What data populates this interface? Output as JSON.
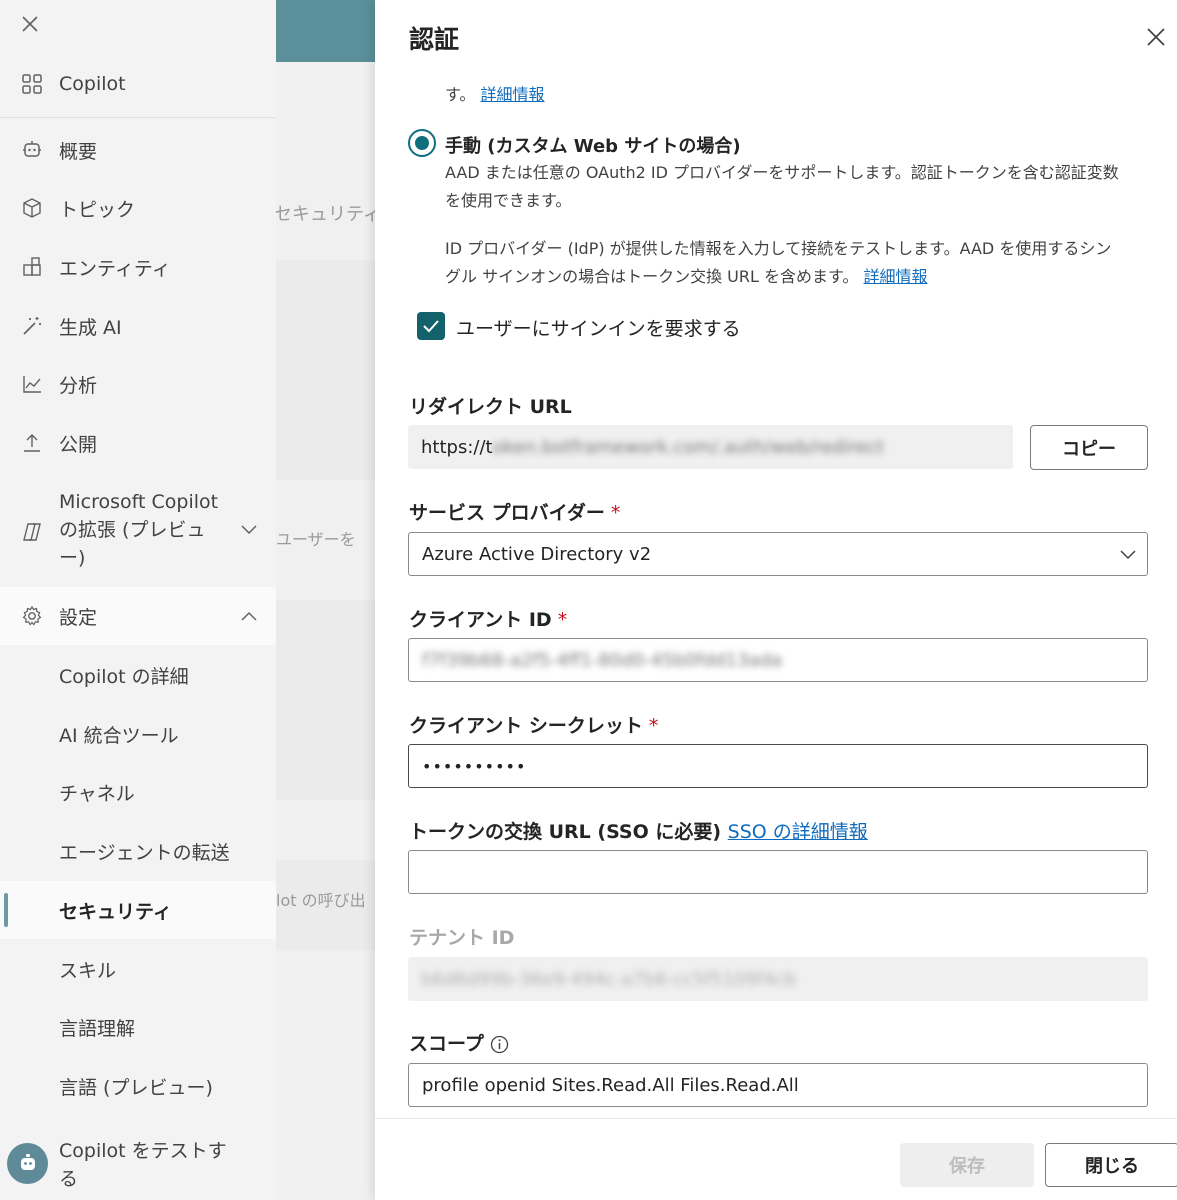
{
  "sidebar": {
    "copilot": "Copilot",
    "items": [
      {
        "label": "概要",
        "icon": "bot-icon"
      },
      {
        "label": "トピック",
        "icon": "cube-icon"
      },
      {
        "label": "エンティティ",
        "icon": "entity-icon"
      },
      {
        "label": "生成 AI",
        "icon": "wand-icon"
      },
      {
        "label": "分析",
        "icon": "chart-icon"
      },
      {
        "label": "公開",
        "icon": "upload-icon"
      }
    ],
    "extensions": "Microsoft Copilot の拡張 (プレビュー)",
    "extensions_lines": [
      "Microsoft Copilot",
      "の拡張 (プレビュ",
      "ー)"
    ],
    "settings": "設定",
    "sub_items": [
      "Copilot の詳細",
      "AI 統合ツール",
      "チャネル",
      "エージェントの転送",
      "セキュリティ",
      "スキル",
      "言語理解",
      "言語 (プレビュー)"
    ],
    "active_sub_item": "セキュリティ",
    "test": {
      "line1": "Copilot をテストす",
      "line2": "る"
    }
  },
  "background": {
    "fragment1": "セキュリティ",
    "fragment2": "ユーザーを",
    "fragment3": "lot の呼び出"
  },
  "panel": {
    "title": "認証",
    "cut_text": "す。",
    "learn_more": "詳細情報",
    "manual": {
      "label": "手動 (カスタム Web サイトの場合)",
      "desc_line1": "AAD または任意の OAuth2 ID プロバイダーをサポートします。認証トークンを含む認証変数",
      "desc_line2": "を使用できます。",
      "idp_line1": "ID プロバイダー (IdP) が提供した情報を入力して接続をテストします。AAD を使用するシン",
      "idp_line2": "グル サインオンの場合はトークン交換 URL を含めます。",
      "learn_more": "詳細情報"
    },
    "require_signin": "ユーザーにサインインを要求する",
    "redirect": {
      "label": "リダイレクト URL",
      "value_visible": "https://t",
      "value_blurred": "oken.botframework.com/.auth/web/redirect",
      "copy": "コピー"
    },
    "provider": {
      "label": "サービス プロバイダー",
      "value": "Azure Active Directory v2"
    },
    "client_id": {
      "label": "クライアント ID",
      "value_blurred": "f7f39b68-a2f5-4ff1-80d0-45b0fdd13ada"
    },
    "client_secret": {
      "label": "クライアント シークレット",
      "value": "••••••••••"
    },
    "token_exchange": {
      "label": "トークンの交換 URL (SSO に必要)",
      "link": "SSO の詳細情報",
      "value": ""
    },
    "tenant": {
      "label": "テナント ID",
      "value_blurred": "b6d6d99b-36e9-494c-a7b6-cc5f5109f4cb"
    },
    "scope": {
      "label": "スコープ",
      "value": "profile openid Sites.Read.All Files.Read.All"
    },
    "required_mark": "*",
    "footer": {
      "save": "保存",
      "close": "閉じる"
    }
  },
  "colors": {
    "accent": "#0f6f7c",
    "active_bar": "#6d9aa5",
    "link": "#0f6cbd",
    "required": "#c50f1f",
    "header_bg": "#5b8f99"
  }
}
